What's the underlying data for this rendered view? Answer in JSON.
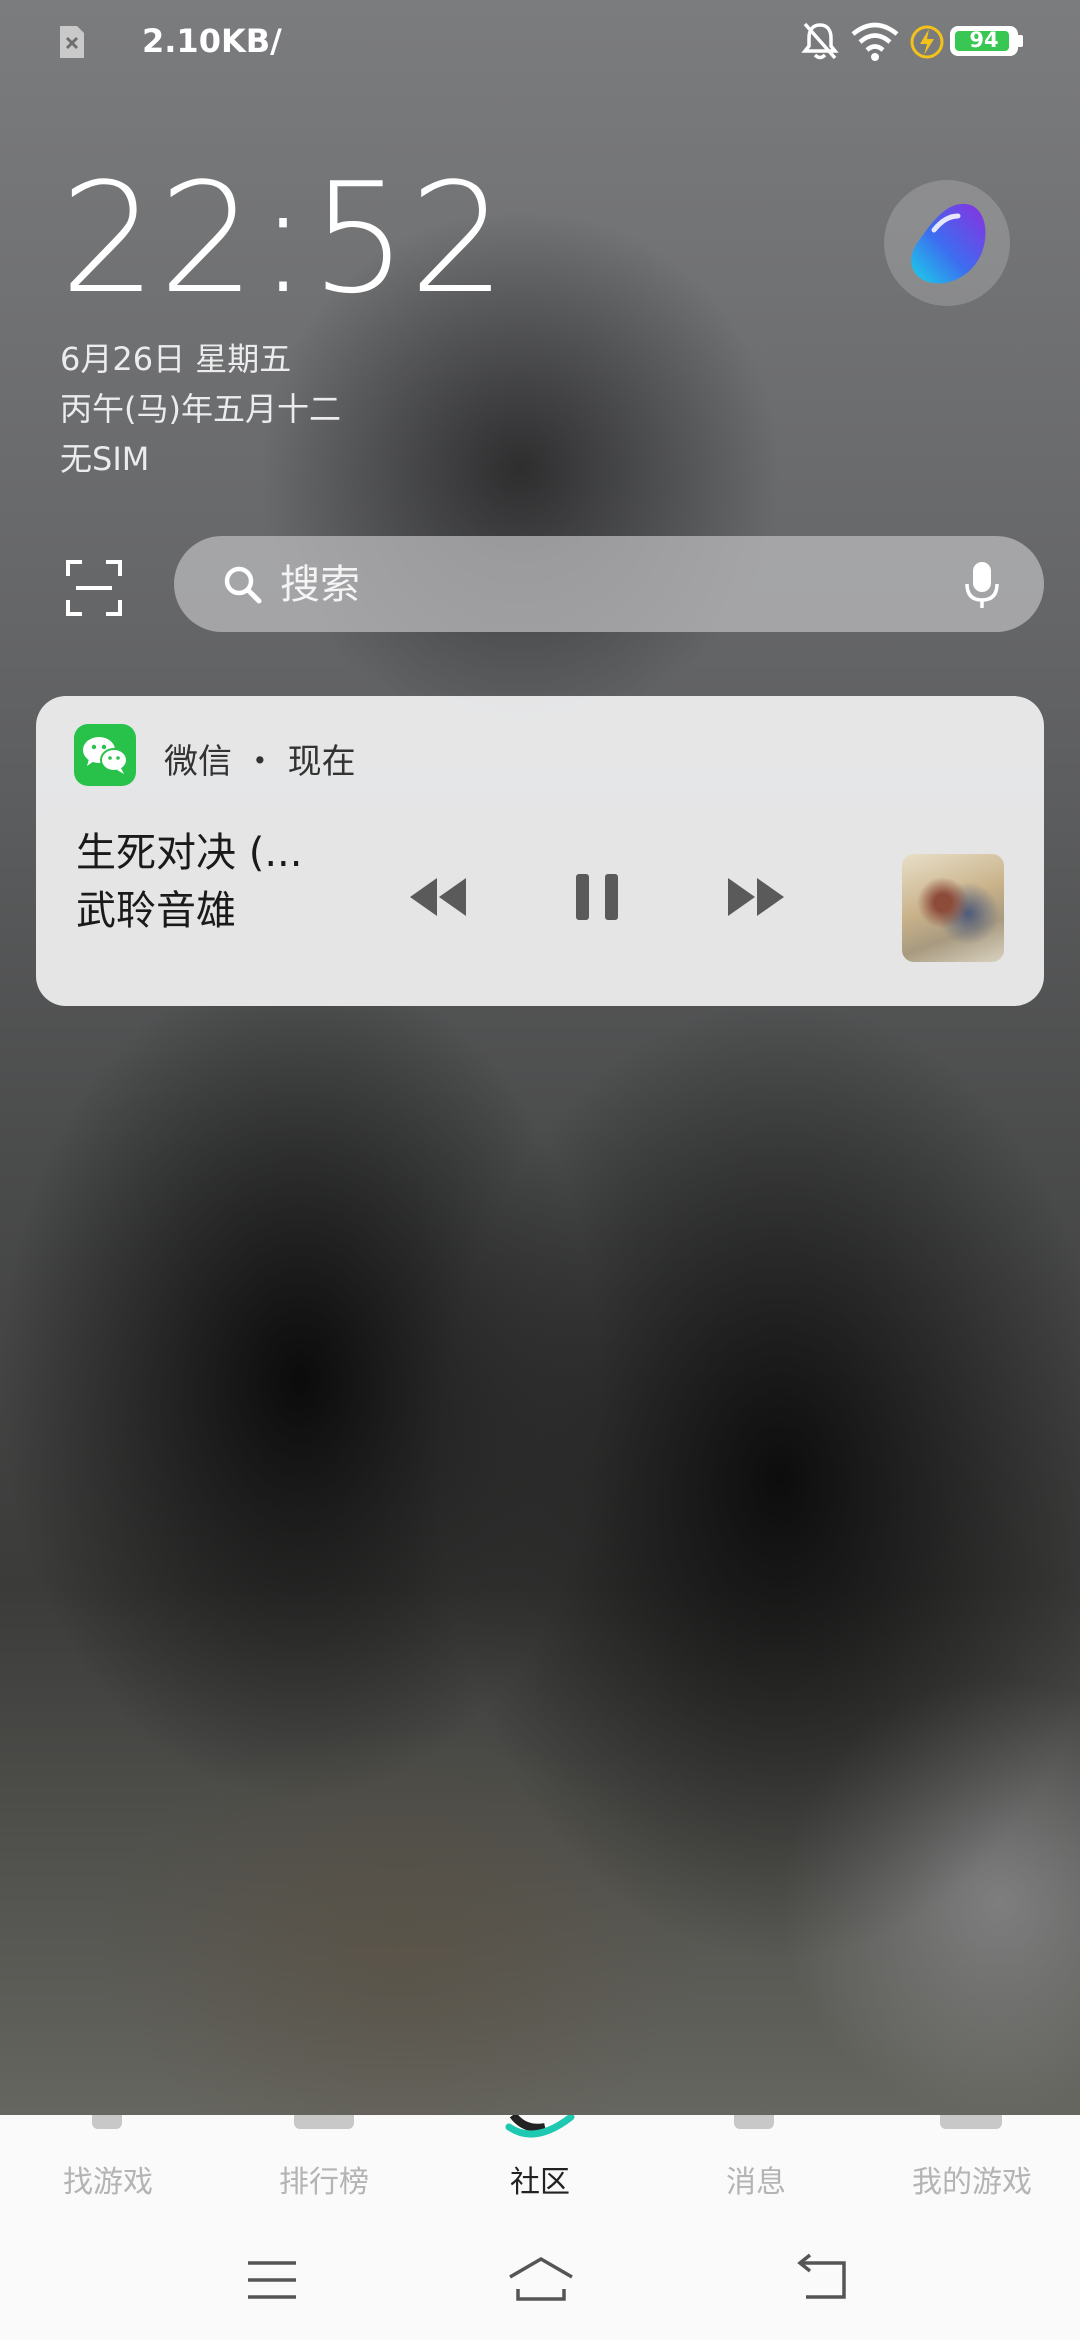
{
  "status_bar": {
    "network_speed": "2.10KB/",
    "battery_level": "94",
    "battery_fraction": 0.94,
    "battery_color": "#37c752"
  },
  "lock_screen": {
    "time": "22:52",
    "date": "6月26日 星期五",
    "lunar_date": "丙午(马)年五月十二",
    "sim_status": "无SIM"
  },
  "search": {
    "placeholder": "搜索"
  },
  "media_notification": {
    "app_name": "微信",
    "separator": "・",
    "time": "现在",
    "track_title": "生死对决 (...",
    "artist": "武聆音雄",
    "app_color": "#28c24a"
  },
  "bottom_nav": {
    "items": [
      {
        "label": "找游戏"
      },
      {
        "label": "排行榜"
      },
      {
        "label": "社区"
      },
      {
        "label": "消息"
      },
      {
        "label": "我的游戏"
      }
    ],
    "active_index": 2,
    "accent_color": "#1fc8b0"
  },
  "icons": {
    "sim": "sim-card-off-icon",
    "bell": "bell-muted-icon",
    "wifi": "wifi-icon",
    "charge": "charging-bolt-icon",
    "assistant": "voice-assistant-orb-icon",
    "scan": "scan-icon",
    "search": "search-icon",
    "mic": "microphone-icon",
    "prev": "rewind-icon",
    "pause": "pause-icon",
    "next": "fast-forward-icon",
    "menu": "menu-icon",
    "home": "home-icon",
    "back": "back-icon"
  }
}
